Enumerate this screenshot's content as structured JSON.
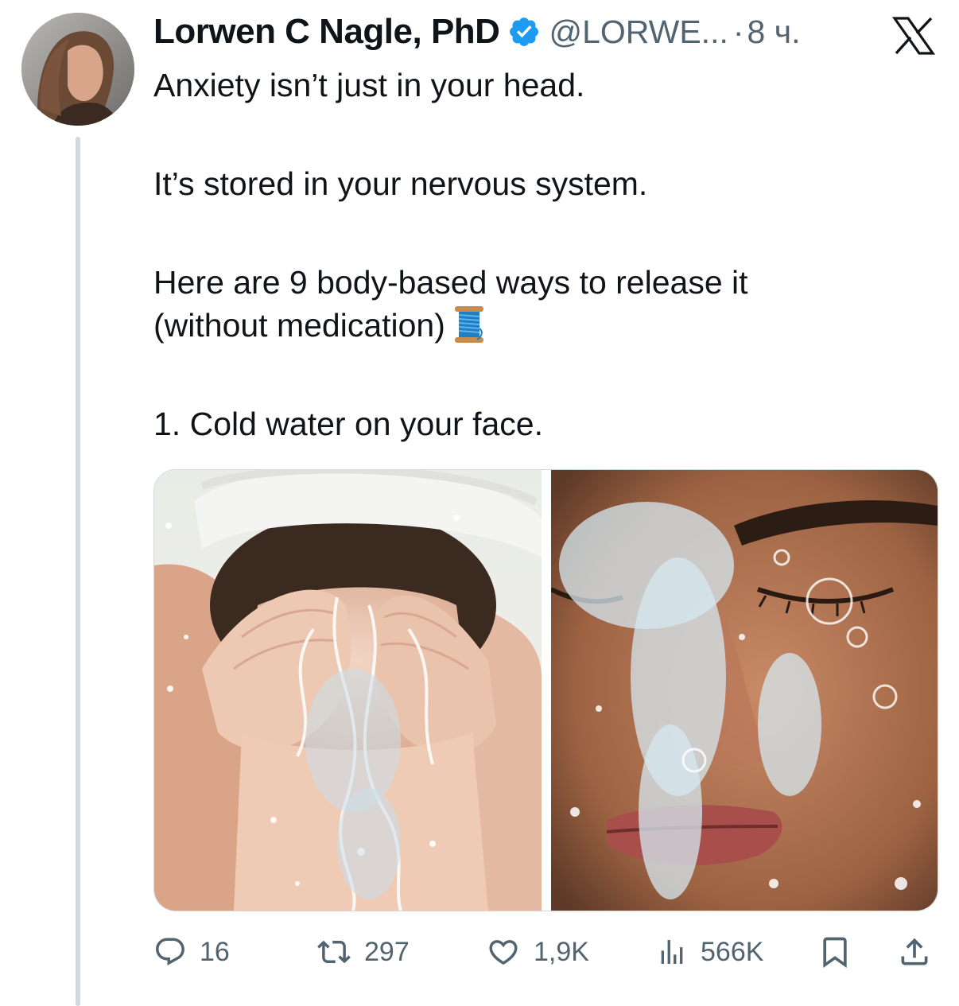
{
  "author": {
    "display_name": "Lorwen C Nagle, PhD",
    "handle": "@LORWE...",
    "separator": "·",
    "time": "8 ч.",
    "verified": true
  },
  "platform_logo": "x-logo-icon",
  "tweet": {
    "paragraphs": [
      "Anxiety isn’t just in your head.",
      "It’s stored in your nervous system.",
      "Here are 9 body-based ways to release it",
      "(without medication)",
      "1. Cold water on your face."
    ],
    "emoji": "spool-of-thread-icon"
  },
  "media": [
    {
      "name": "woman-splashing-water-on-face-photo"
    },
    {
      "name": "face-under-water-stream-photo"
    }
  ],
  "actions": {
    "replies": "16",
    "reposts": "297",
    "likes": "1,9K",
    "views": "566K",
    "icons": [
      "reply-icon",
      "repost-icon",
      "like-icon",
      "views-icon",
      "bookmark-icon",
      "share-icon"
    ]
  },
  "colors": {
    "text": "#0f1419",
    "secondary": "#536471",
    "verified_blue": "#1d9bf0",
    "thread_line": "#cfd9de"
  }
}
